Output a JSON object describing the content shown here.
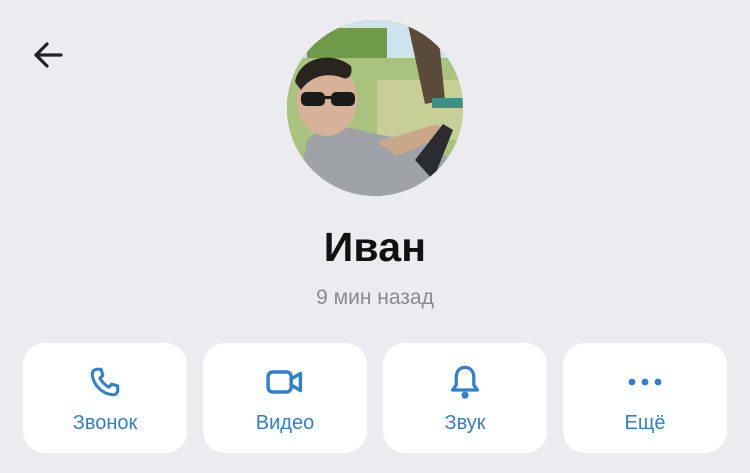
{
  "header": {
    "back_icon": "arrow-left-icon"
  },
  "profile": {
    "avatar": "profile-photo",
    "name": "Иван",
    "last_seen": "9 мин назад"
  },
  "actions": [
    {
      "label": "Звонок",
      "icon": "phone-icon"
    },
    {
      "label": "Видео",
      "icon": "video-camera-icon"
    },
    {
      "label": "Звук",
      "icon": "bell-icon"
    },
    {
      "label": "Ещё",
      "icon": "more-dots-icon"
    }
  ],
  "colors": {
    "background": "#ececf0",
    "accent": "#2f7fd0",
    "card": "#ffffff",
    "secondary_text": "#8a8a8e"
  }
}
